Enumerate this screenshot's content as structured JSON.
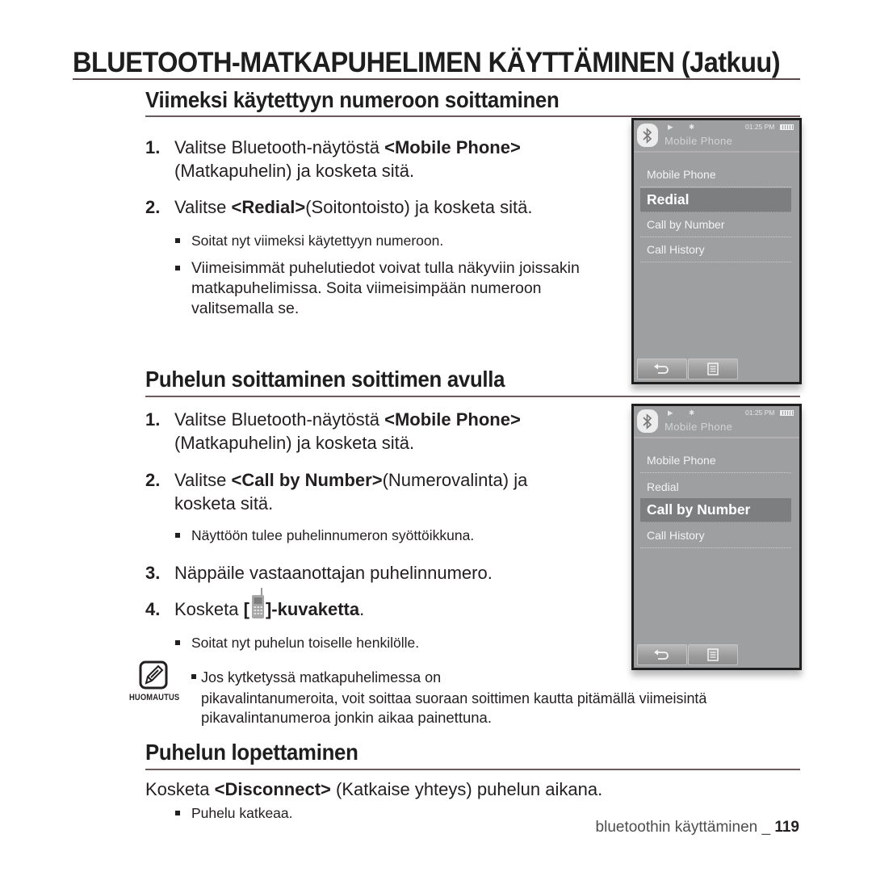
{
  "page_title": "BLUETOOTH-MATKAPUHELIMEN KÄYTTÄMINEN (Jatkuu)",
  "sections": [
    {
      "heading": "Viimeksi käytettyyn numeroon soittaminen",
      "steps": [
        {
          "num": "1.",
          "pre": "Valitse Bluetooth-näytöstä ",
          "bold": "<Mobile Phone>",
          "post": "",
          "line2": "(Matkapuhelin) ja kosketa sitä."
        },
        {
          "num": "2.",
          "pre": "Valitse ",
          "bold": "<Redial>",
          "post": "(Soitontoisto) ja kosketa sitä."
        }
      ],
      "bullets": [
        "Soitat nyt viimeksi käytettyyn numeroon.",
        "Viimeisimmät puhelutiedot voivat tulla näkyviin joissakin matkapuhelimissa. Soita viimeisimpään numeroon valitsemalla se."
      ]
    },
    {
      "heading": "Puhelun soittaminen soittimen avulla",
      "steps": [
        {
          "num": "1.",
          "pre": "Valitse Bluetooth-näytöstä ",
          "bold": "<Mobile Phone>",
          "post": "",
          "line2": "(Matkapuhelin) ja kosketa sitä."
        },
        {
          "num": "2.",
          "pre": "Valitse ",
          "bold": "<Call by Number>",
          "post": "(Numerovalinta) ja",
          "line2": "kosketa sitä."
        },
        {
          "num": "3.",
          "text": "Näppäile vastaanottajan puhelinnumero."
        },
        {
          "num": "4.",
          "pre": "Kosketa ",
          "bracket_open": "[",
          "icon": "mobile-phone-icon",
          "bold": "]-kuvaketta",
          "post": "."
        }
      ],
      "bullets": [
        "Näyttöön tulee puhelinnumeron syöttöikkuna.",
        "Soitat nyt puhelun toiselle henkilölle."
      ]
    },
    {
      "heading": "Puhelun lopettaminen",
      "instruction": {
        "pre": "Kosketa ",
        "bold": "<Disconnect>",
        "post": " (Katkaise yhteys) puhelun aikana."
      },
      "bullets": [
        "Puhelu katkeaa."
      ]
    }
  ],
  "note": {
    "label": "HUOMAUTUS",
    "text_line1": "Jos kytketyssä matkapuhelimessa on",
    "text_line2": "pikavalintanumeroita, voit soittaa suoraan soittimen kautta pitämällä viimeisintä",
    "text_line3": "pikavalintanumeroa jonkin aikaa painettuna."
  },
  "screens": [
    {
      "time": "01:25 PM",
      "title": "Mobile Phone",
      "menu": [
        "Mobile Phone",
        "Redial",
        "Call by Number",
        "Call History"
      ],
      "selected_index": 1,
      "buttons": [
        "back-icon",
        "menu-icon"
      ]
    },
    {
      "time": "01:25 PM",
      "title": "Mobile Phone",
      "menu": [
        "Mobile Phone",
        "Redial",
        "Call by Number",
        "Call History"
      ],
      "selected_index": 2,
      "buttons": [
        "back-icon",
        "menu-icon"
      ]
    }
  ],
  "footer": {
    "text": "bluetoothin käyttäminen _ ",
    "page": "119"
  }
}
